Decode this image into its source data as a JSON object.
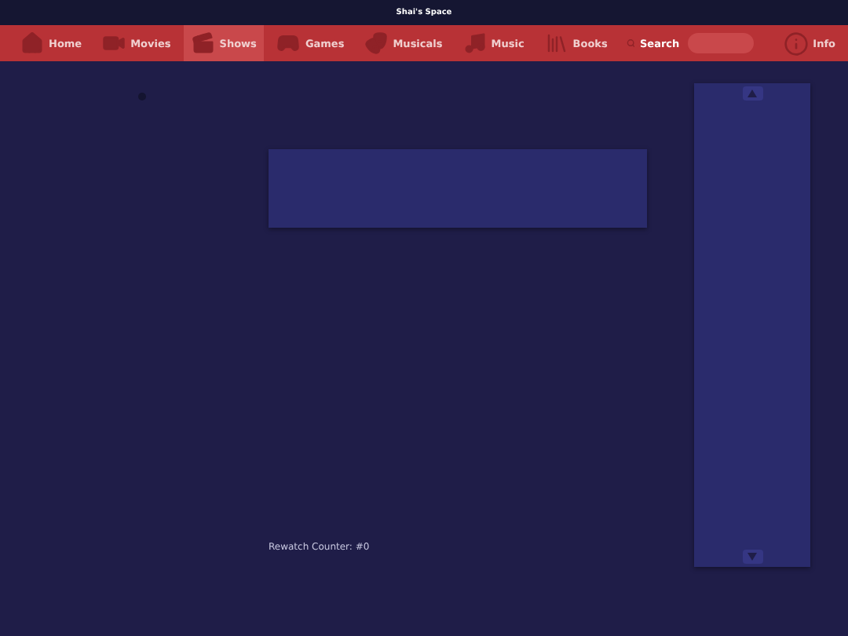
{
  "window": {
    "title": "Shai's Space"
  },
  "nav": {
    "items": [
      {
        "label": "Home",
        "selected": false
      },
      {
        "label": "Movies",
        "selected": false
      },
      {
        "label": "Shows",
        "selected": true
      },
      {
        "label": "Games",
        "selected": false
      },
      {
        "label": "Musicals",
        "selected": false
      },
      {
        "label": "Music",
        "selected": false
      },
      {
        "label": "Books",
        "selected": false
      }
    ],
    "search": {
      "label": "Search"
    },
    "info": {
      "label": "Info"
    }
  },
  "counter": {
    "text": "Rewatch Counter: #0"
  }
}
